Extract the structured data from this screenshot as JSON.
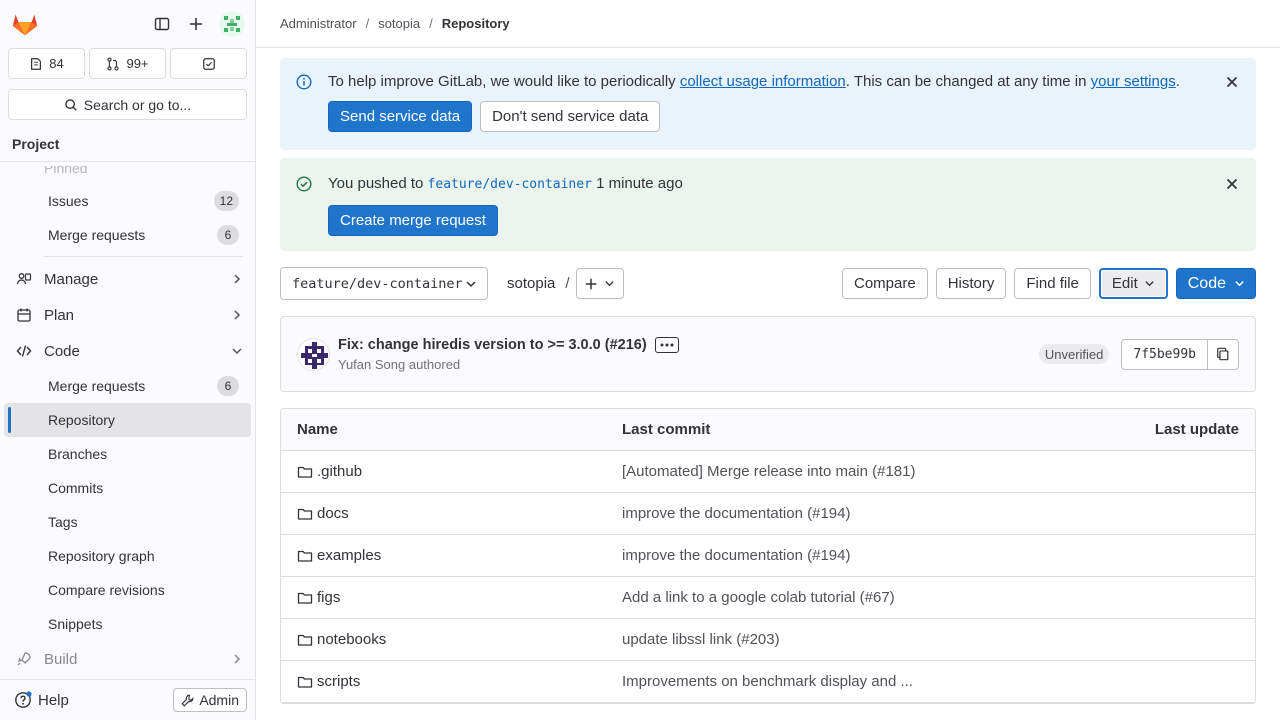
{
  "sidebar": {
    "counts": {
      "issues": "84",
      "merge_requests": "99+"
    },
    "search_label": "Search or go to...",
    "section_title": "Project",
    "pinned_label": "Pinned",
    "pinned_items": [
      {
        "label": "Issues",
        "badge": "12"
      },
      {
        "label": "Merge requests",
        "badge": "6"
      }
    ],
    "groups": {
      "manage": "Manage",
      "plan": "Plan",
      "code": "Code",
      "build": "Build"
    },
    "code_items": [
      {
        "label": "Merge requests",
        "badge": "6"
      },
      {
        "label": "Repository"
      },
      {
        "label": "Branches"
      },
      {
        "label": "Commits"
      },
      {
        "label": "Tags"
      },
      {
        "label": "Repository graph"
      },
      {
        "label": "Compare revisions"
      },
      {
        "label": "Snippets"
      }
    ],
    "help_label": "Help",
    "admin_label": "Admin"
  },
  "breadcrumb": [
    "Administrator",
    "sotopia",
    "Repository"
  ],
  "info_alert": {
    "text_before": "To help improve GitLab, we would like to periodically ",
    "link1": "collect usage information",
    "text_middle": ". This can be changed at any time in ",
    "link2": "your settings",
    "text_after": ".",
    "primary_btn": "Send service data",
    "secondary_btn": "Don't send service data"
  },
  "push_alert": {
    "text_before": "You pushed to ",
    "branch": "feature/dev-container",
    "text_after": " 1 minute ago",
    "button": "Create merge request"
  },
  "toolbar": {
    "branch": "feature/dev-container",
    "project": "sotopia",
    "path_sep": "/",
    "compare": "Compare",
    "history": "History",
    "find_file": "Find file",
    "edit": "Edit",
    "code": "Code"
  },
  "commit": {
    "title": "Fix: change hiredis version to >= 3.0.0 (#216)",
    "author": "Yufan Song authored",
    "status": "Unverified",
    "sha": "7f5be99b"
  },
  "file_table": {
    "headers": {
      "name": "Name",
      "last_commit": "Last commit",
      "last_update": "Last update"
    },
    "rows": [
      {
        "name": ".github",
        "commit": "[Automated] Merge release into main (#181)"
      },
      {
        "name": "docs",
        "commit": "improve the documentation (#194)"
      },
      {
        "name": "examples",
        "commit": "improve the documentation (#194)"
      },
      {
        "name": "figs",
        "commit": "Add a link to a google colab tutorial (#67)"
      },
      {
        "name": "notebooks",
        "commit": "update libssl link (#203)"
      },
      {
        "name": "scripts",
        "commit": "Improvements on benchmark display and ..."
      }
    ]
  },
  "colors": {
    "primary": "#1f75cb",
    "info_bg": "#e9f3fc",
    "success_bg": "#ecf4ee",
    "gitlab_orange": "#fc6d26"
  }
}
